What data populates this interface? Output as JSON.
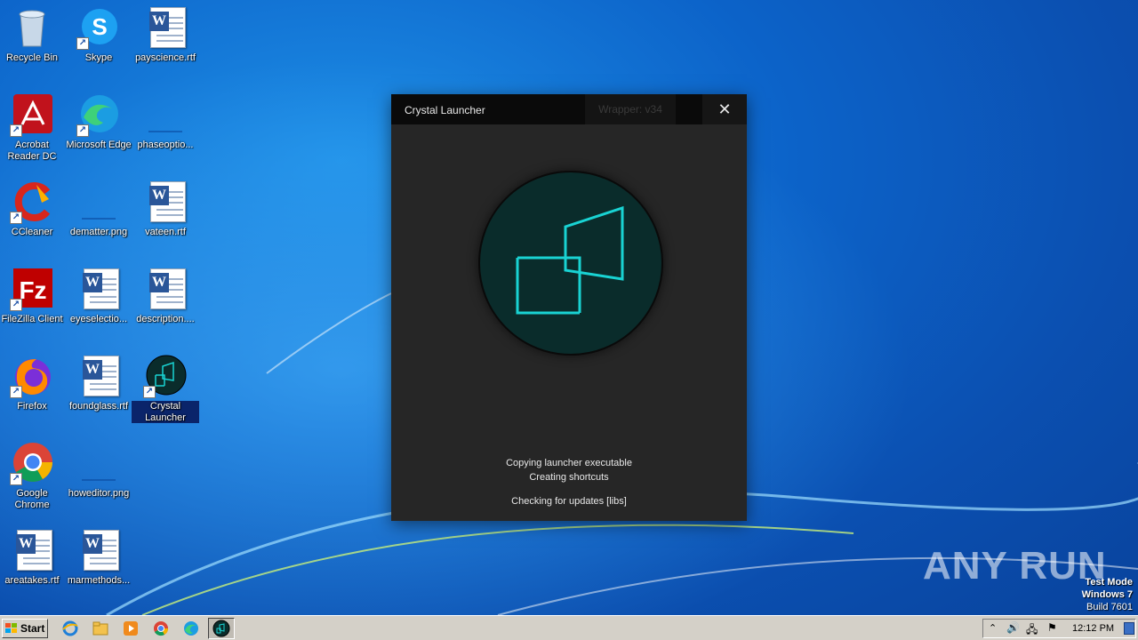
{
  "desktop": {
    "icons": [
      {
        "label": "Recycle Bin",
        "icon": "recycle-bin-icon"
      },
      {
        "label": "Skype",
        "icon": "skype-icon"
      },
      {
        "label": "payscience.rtf",
        "icon": "word-document-icon"
      },
      {
        "label": "Acrobat Reader DC",
        "icon": "acrobat-icon"
      },
      {
        "label": "Microsoft Edge",
        "icon": "edge-icon"
      },
      {
        "label": "phaseoptio...",
        "icon": "image-file-icon"
      },
      {
        "label": "CCleaner",
        "icon": "ccleaner-icon"
      },
      {
        "label": "dematter.png",
        "icon": "image-file-icon"
      },
      {
        "label": "vateen.rtf",
        "icon": "word-document-icon"
      },
      {
        "label": "FileZilla Client",
        "icon": "filezilla-icon"
      },
      {
        "label": "eyeselectio...",
        "icon": "word-document-icon"
      },
      {
        "label": "description....",
        "icon": "word-document-icon"
      },
      {
        "label": "Firefox",
        "icon": "firefox-icon"
      },
      {
        "label": "foundglass.rtf",
        "icon": "word-document-icon"
      },
      {
        "label": "Crystal Launcher",
        "icon": "crystal-launcher-icon"
      },
      {
        "label": "Google Chrome",
        "icon": "chrome-icon"
      },
      {
        "label": "howeditor.png",
        "icon": "image-file-icon"
      },
      {
        "label": "areatakes.rtf",
        "icon": "word-document-icon"
      },
      {
        "label": "marmethods...",
        "icon": "word-document-icon"
      }
    ]
  },
  "dialog": {
    "title": "Crystal Launcher",
    "version": "Wrapper: v34",
    "close_glyph": "✕",
    "status_lines": [
      "Copying launcher executable",
      "Creating shortcuts",
      "Checking for updates [libs]"
    ],
    "accent_color": "#19d3d3"
  },
  "taskbar": {
    "start_label": "Start",
    "clock": "12:12 PM",
    "watermark": [
      "Test Mode",
      "Windows 7",
      "Build 7601"
    ],
    "brand": "ANY RUN"
  }
}
